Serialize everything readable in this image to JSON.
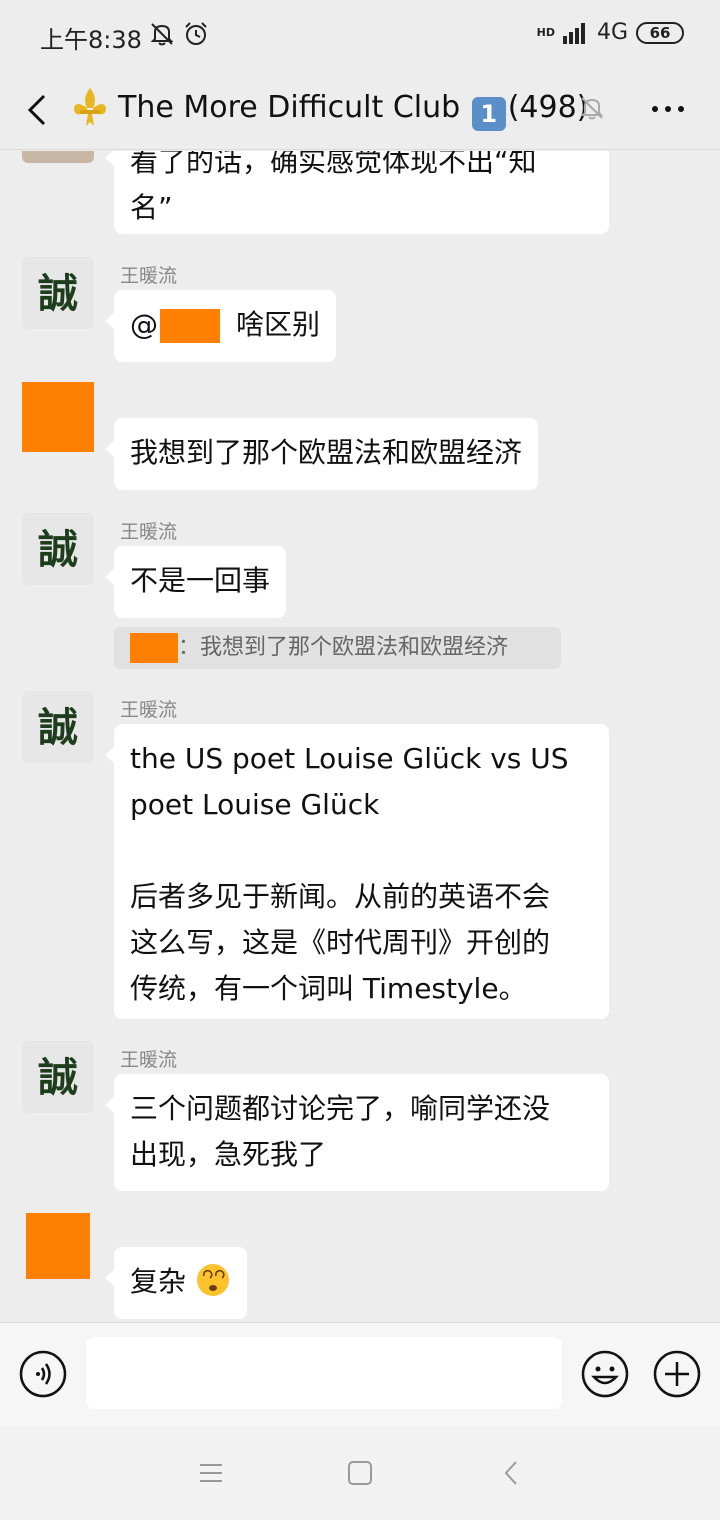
{
  "status_bar": {
    "time": "上午8:38",
    "signal": "HD",
    "network": "4G",
    "battery": "66"
  },
  "header": {
    "title": "The More Difficult Club",
    "badge": "1",
    "member_count": "(498)"
  },
  "messages": [
    {
      "sender": "",
      "avatar": "partial-avatar",
      "text_lines": [
        "看了的话，确实感觉体现不出“知",
        "名”"
      ]
    },
    {
      "sender": "王暖流",
      "avatar": "cheng-calligraphy",
      "text_prefix": "@",
      "text_suffix": "啥区别"
    },
    {
      "sender": "",
      "avatar": "redacted",
      "text": "我想到了那个欧盟法和欧盟经济"
    },
    {
      "sender": "王暖流",
      "avatar": "cheng-calligraphy",
      "text": "不是一回事",
      "quote": "：我想到了那个欧盟法和欧盟经济"
    },
    {
      "sender": "王暖流",
      "avatar": "cheng-calligraphy",
      "text_lines": [
        "the US poet Louise Glück vs US",
        "poet Louise Glück",
        "",
        "后者多见于新闻。从前的英语不会",
        "这么写，这是《时代周刊》开创的",
        "传统，有一个词叫 Timestyle。"
      ]
    },
    {
      "sender": "王暖流",
      "avatar": "cheng-calligraphy",
      "text_lines": [
        "三个问题都讨论完了，喻同学还没",
        "出现，急死我了"
      ]
    },
    {
      "sender": "",
      "avatar": "redacted",
      "text": "复杂"
    }
  ],
  "avatar_glyph": "誠",
  "colors": {
    "background": "#ededed",
    "bubble": "#ffffff",
    "redaction": "#ff8000",
    "sender_name": "#888888"
  },
  "icons": [
    "back-icon",
    "fleur-de-lis-icon",
    "mute-bell-icon",
    "more-icon",
    "voice-icon",
    "emoji-icon",
    "plus-icon",
    "menu-icon",
    "home-icon",
    "nav-back-icon"
  ]
}
